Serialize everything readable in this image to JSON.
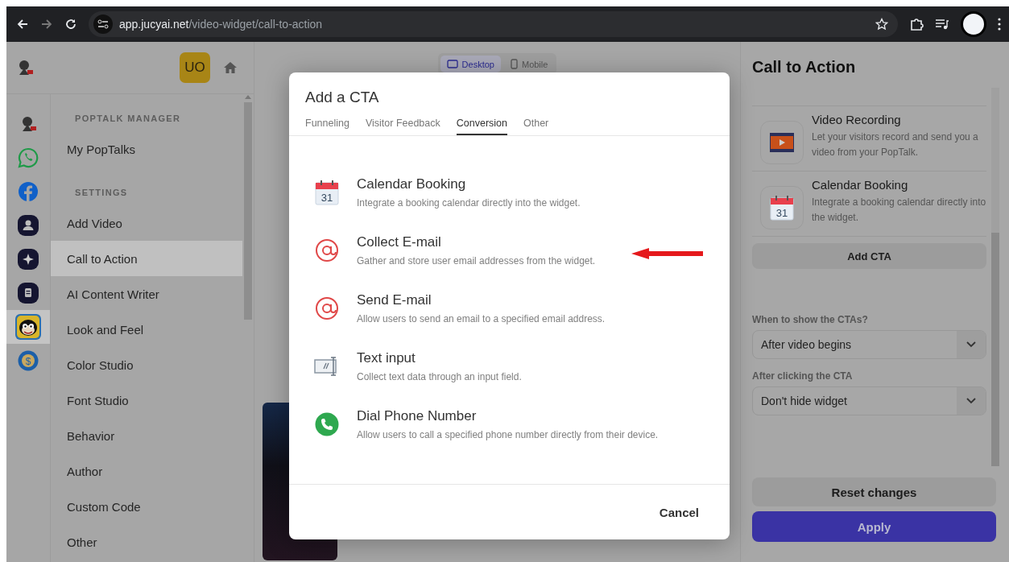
{
  "browser": {
    "url": {
      "host": "app.jucyai.net",
      "path": "/video-widget/call-to-action"
    }
  },
  "header": {
    "avatar": "UO"
  },
  "rail": [
    {
      "selected": false
    },
    {
      "selected": false
    },
    {
      "selected": false
    },
    {
      "selected": false
    },
    {
      "selected": false
    },
    {
      "selected": false
    },
    {
      "selected": true
    },
    {
      "selected": false,
      "icon_text": "$"
    }
  ],
  "sidebar": {
    "sections": [
      {
        "title": "POPTALK MANAGER",
        "items": [
          {
            "label": "My PopTalks",
            "selected": false
          }
        ]
      },
      {
        "title": "SETTINGS",
        "items": [
          {
            "label": "Add Video",
            "selected": false
          },
          {
            "label": "Call to Action",
            "selected": true
          },
          {
            "label": "AI Content Writer",
            "selected": false
          },
          {
            "label": "Look and Feel",
            "selected": false
          },
          {
            "label": "Color Studio",
            "selected": false
          },
          {
            "label": "Font Studio",
            "selected": false
          },
          {
            "label": "Behavior",
            "selected": false
          },
          {
            "label": "Author",
            "selected": false
          },
          {
            "label": "Custom Code",
            "selected": false
          },
          {
            "label": "Other",
            "selected": false
          }
        ]
      }
    ]
  },
  "preview": {
    "view_toggle": [
      {
        "label": "Desktop",
        "selected": true
      },
      {
        "label": "Mobile",
        "selected": false
      }
    ]
  },
  "modal": {
    "title": "Add a CTA",
    "tabs": [
      {
        "label": "Funneling",
        "selected": false
      },
      {
        "label": "Visitor Feedback",
        "selected": false
      },
      {
        "label": "Conversion",
        "selected": true
      },
      {
        "label": "Other",
        "selected": false
      }
    ],
    "items": [
      {
        "title": "Calendar Booking",
        "description": "Integrate a booking calendar directly into the widget.",
        "icon_text": "31"
      },
      {
        "title": "Collect E-mail",
        "description": "Gather and store user email addresses from the widget."
      },
      {
        "title": "Send E-mail",
        "description": "Allow users to send an email to a specified email address."
      },
      {
        "title": "Text input",
        "description": "Collect text data through an input field."
      },
      {
        "title": "Dial Phone Number",
        "description": "Allow users to call a specified phone number directly from their device."
      }
    ],
    "cancel": "Cancel"
  },
  "panel": {
    "title": "Call to Action",
    "cards": [
      {
        "title": "Video Recording",
        "description": "Let your visitors record and send you a video from your PopTalk."
      },
      {
        "title": "Calendar Booking",
        "description": "Integrate a booking calendar directly into the widget.",
        "icon_text": "31"
      }
    ],
    "add_button": "Add CTA",
    "fields": [
      {
        "label": "When to show the CTAs?",
        "value": "After video begins"
      },
      {
        "label": "After clicking the CTA",
        "value": "Don't hide widget"
      }
    ],
    "reset_button": "Reset changes",
    "apply_button": "Apply"
  }
}
